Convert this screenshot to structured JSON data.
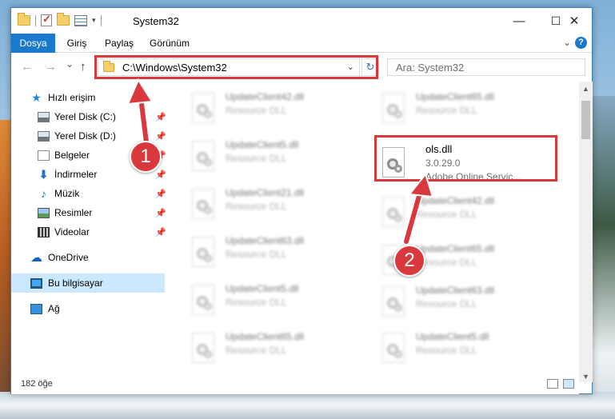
{
  "window": {
    "title": "System32",
    "controls": {
      "minimize": "—",
      "maximize": "☐",
      "close": "✕"
    }
  },
  "ribbon": {
    "tabs": [
      "Dosya",
      "Giriş",
      "Paylaş",
      "Görünüm"
    ],
    "expand_icon": "chevron-down",
    "help": "?"
  },
  "nav": {
    "back": "←",
    "forward": "→",
    "recent": "⌄",
    "up": "↑",
    "address": "C:\\Windows\\System32",
    "refresh": "↻",
    "search_placeholder": "Ara: System32"
  },
  "sidebar": {
    "items": [
      {
        "label": "Hızlı erişim",
        "icon": "star-icon"
      },
      {
        "label": "Yerel Disk (C:)",
        "icon": "disk-icon",
        "pinned": true
      },
      {
        "label": "Yerel Disk (D:)",
        "icon": "disk-icon",
        "pinned": true
      },
      {
        "label": "Belgeler",
        "icon": "documents-icon",
        "pinned": true
      },
      {
        "label": "İndirmeler",
        "icon": "download-icon",
        "pinned": true
      },
      {
        "label": "Müzik",
        "icon": "music-icon",
        "pinned": true
      },
      {
        "label": "Resimler",
        "icon": "pictures-icon",
        "pinned": true
      },
      {
        "label": "Videolar",
        "icon": "video-icon",
        "pinned": true
      },
      {
        "label": "OneDrive",
        "icon": "cloud-icon"
      },
      {
        "label": "Bu bilgisayar",
        "icon": "computer-icon",
        "selected": true
      },
      {
        "label": "Ağ",
        "icon": "network-icon"
      }
    ],
    "pin_glyph": "📌"
  },
  "files": {
    "left_column": [
      {
        "name": "UpdateClient42.dll",
        "desc": "Resource DLL"
      },
      {
        "name": "UpdateClient5.dll",
        "desc": "Resource DLL"
      },
      {
        "name": "UpdateClient21.dll",
        "desc": "Resource DLL"
      },
      {
        "name": "UpdateClient63.dll",
        "desc": "Resource DLL"
      },
      {
        "name": "UpdateClient5.dll",
        "desc": "Resource DLL"
      },
      {
        "name": "UpdateClient65.dll",
        "desc": "Resource DLL"
      }
    ],
    "right_column": [
      {
        "name": "UpdateClient65.dll",
        "desc": "Resource DLL"
      },
      {
        "name": "UpdateClient42.dll",
        "desc": "Resource DLL"
      },
      {
        "name": "UpdateClient65.dll",
        "desc": "Resource DLL"
      },
      {
        "name": "UpdateClient63.dll",
        "desc": "Resource DLL"
      },
      {
        "name": "UpdateClient5.dll",
        "desc": "Resource DLL"
      }
    ],
    "highlighted": {
      "name": "ols.dll",
      "version": "3.0.29.0",
      "desc": "Adobe Online Servic..."
    }
  },
  "status": {
    "count": "182 öğe"
  },
  "annotations": {
    "step1": "1",
    "step2": "2",
    "color": "#d9393c"
  }
}
